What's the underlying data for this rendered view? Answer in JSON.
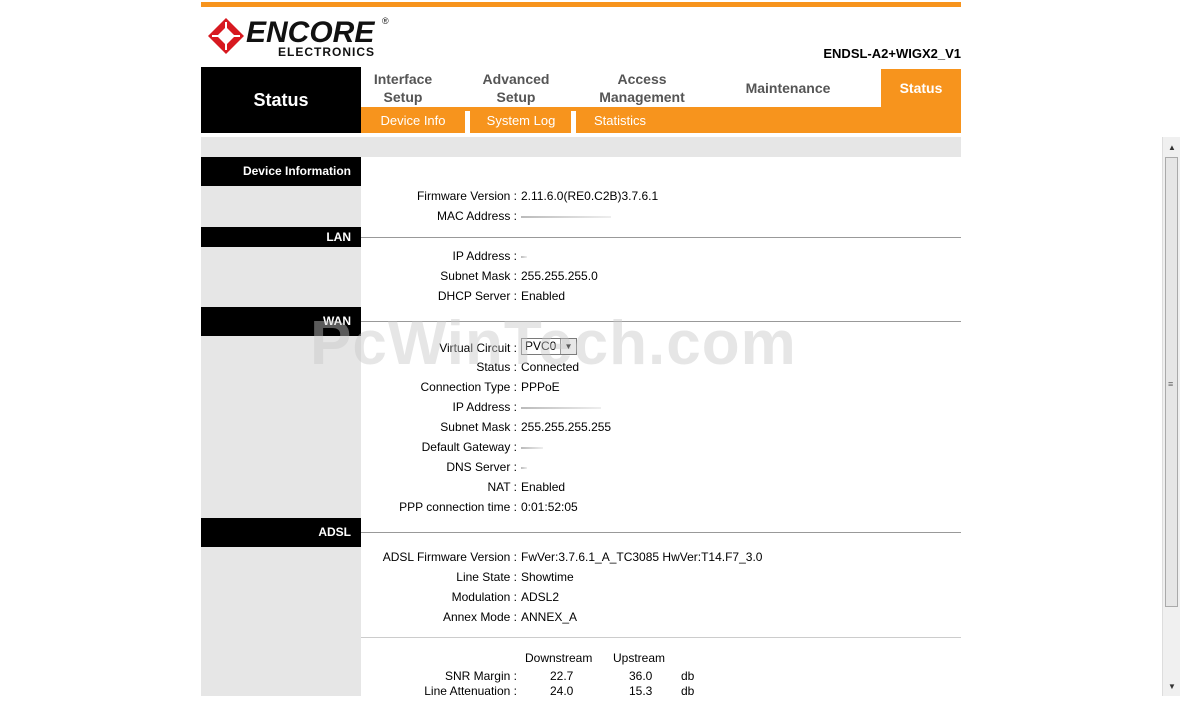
{
  "header": {
    "logo_text": "ENCORE",
    "logo_sub": "ELECTRONICS",
    "model": "ENDSL-A2+WIGX2_V1",
    "section_title": "Status"
  },
  "nav": {
    "items": [
      {
        "label_line1": "Interface",
        "label_line2": "Setup"
      },
      {
        "label_line1": "Advanced",
        "label_line2": "Setup"
      },
      {
        "label_line1": "Access",
        "label_line2": "Management"
      },
      {
        "label_line1": "Maintenance",
        "label_line2": ""
      },
      {
        "label_line1": "Status",
        "label_line2": ""
      }
    ],
    "sub_items": [
      "Device Info",
      "System Log",
      "Statistics"
    ]
  },
  "sections": {
    "device_info": "Device Information",
    "lan": "LAN",
    "wan": "WAN",
    "adsl": "ADSL"
  },
  "device": {
    "firmware_label": "Firmware Version :",
    "firmware_value": "2.11.6.0(RE0.C2B)3.7.6.1",
    "mac_label": "MAC Address :"
  },
  "lan": {
    "ip_label": "IP Address :",
    "mask_label": "Subnet Mask :",
    "mask_value": "255.255.255.0",
    "dhcp_label": "DHCP Server :",
    "dhcp_value": "Enabled"
  },
  "wan": {
    "vc_label": "Virtual Circuit :",
    "vc_value": "PVC0",
    "status_label": "Status :",
    "status_value": "Connected",
    "conn_label": "Connection Type :",
    "conn_value": "PPPoE",
    "ip_label": "IP Address :",
    "mask_label": "Subnet Mask :",
    "mask_value": "255.255.255.255",
    "gw_label": "Default Gateway :",
    "dns_label": "DNS Server :",
    "nat_label": "NAT :",
    "nat_value": "Enabled",
    "ppp_label": "PPP connection time :",
    "ppp_value": "0:01:52:05"
  },
  "adsl": {
    "fw_label": "ADSL Firmware Version :",
    "fw_value": "FwVer:3.7.6.1_A_TC3085 HwVer:T14.F7_3.0",
    "line_label": "Line State :",
    "line_value": "Showtime",
    "mod_label": "Modulation :",
    "mod_value": "ADSL2",
    "annex_label": "Annex Mode :",
    "annex_value": "ANNEX_A",
    "col_down": "Downstream",
    "col_up": "Upstream",
    "snr_label": "SNR Margin :",
    "snr_down": "22.7",
    "snr_up": "36.0",
    "snr_unit": "db",
    "att_label": "Line Attenuation :",
    "att_down": "24.0",
    "att_up": "15.3",
    "att_unit": "db"
  },
  "watermark": "PcWinTech.com",
  "colors": {
    "accent": "#f7941d",
    "dark": "#000000",
    "panel": "#e6e6e6"
  }
}
